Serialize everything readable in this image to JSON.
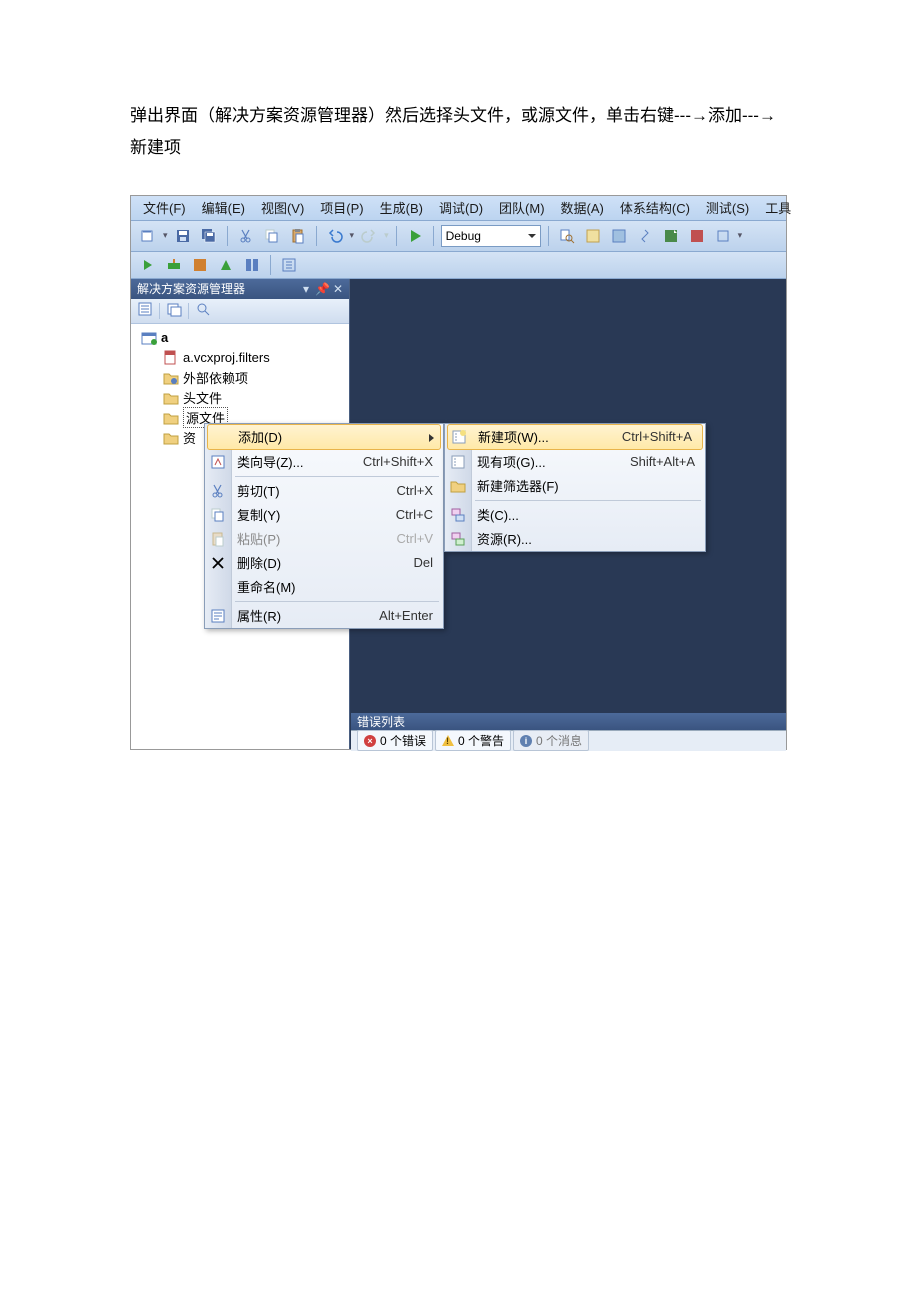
{
  "instruction": "弹出界面（解决方案资源管理器）然后选择头文件，或源文件，单击右键---→添加---→新建项",
  "menubar": {
    "items": [
      {
        "label": "文件(F)"
      },
      {
        "label": "编辑(E)"
      },
      {
        "label": "视图(V)"
      },
      {
        "label": "项目(P)"
      },
      {
        "label": "生成(B)"
      },
      {
        "label": "调试(D)"
      },
      {
        "label": "团队(M)"
      },
      {
        "label": "数据(A)"
      },
      {
        "label": "体系结构(C)"
      },
      {
        "label": "测试(S)"
      },
      {
        "label": "工具"
      }
    ]
  },
  "toolbar": {
    "config_dropdown": "Debug"
  },
  "sidebar": {
    "title": "解决方案资源管理器",
    "project": "a",
    "items": [
      {
        "label": "a.vcxproj.filters"
      },
      {
        "label": "外部依赖项"
      },
      {
        "label": "头文件"
      },
      {
        "label": "源文件"
      },
      {
        "label": "资"
      }
    ]
  },
  "context_menu_1": {
    "items": [
      {
        "label": "添加(D)",
        "shortcut": "",
        "has_submenu": true,
        "highlighted": true,
        "icon": ""
      },
      {
        "label": "类向导(Z)...",
        "shortcut": "Ctrl+Shift+X",
        "icon": "wizard"
      },
      {
        "sep": true
      },
      {
        "label": "剪切(T)",
        "shortcut": "Ctrl+X",
        "icon": "cut"
      },
      {
        "label": "复制(Y)",
        "shortcut": "Ctrl+C",
        "icon": "copy"
      },
      {
        "label": "粘贴(P)",
        "shortcut": "Ctrl+V",
        "disabled": true,
        "icon": "paste"
      },
      {
        "label": "删除(D)",
        "shortcut": "Del",
        "icon": "delete"
      },
      {
        "label": "重命名(M)",
        "shortcut": ""
      },
      {
        "sep": true
      },
      {
        "label": "属性(R)",
        "shortcut": "Alt+Enter",
        "icon": "props"
      }
    ]
  },
  "context_menu_2": {
    "items": [
      {
        "label": "新建项(W)...",
        "shortcut": "Ctrl+Shift+A",
        "icon": "newitem",
        "highlighted": true
      },
      {
        "label": "现有项(G)...",
        "shortcut": "Shift+Alt+A",
        "icon": "existitem"
      },
      {
        "label": "新建筛选器(F)",
        "shortcut": "",
        "icon": "folder"
      },
      {
        "sep": true
      },
      {
        "label": "类(C)...",
        "shortcut": "",
        "icon": "class"
      },
      {
        "label": "资源(R)...",
        "shortcut": "",
        "icon": "resource"
      }
    ]
  },
  "errorlist": {
    "title": "错误列表",
    "tabs": {
      "errors": "0 个错误",
      "warnings": "0 个警告",
      "messages": "0 个消息"
    }
  }
}
